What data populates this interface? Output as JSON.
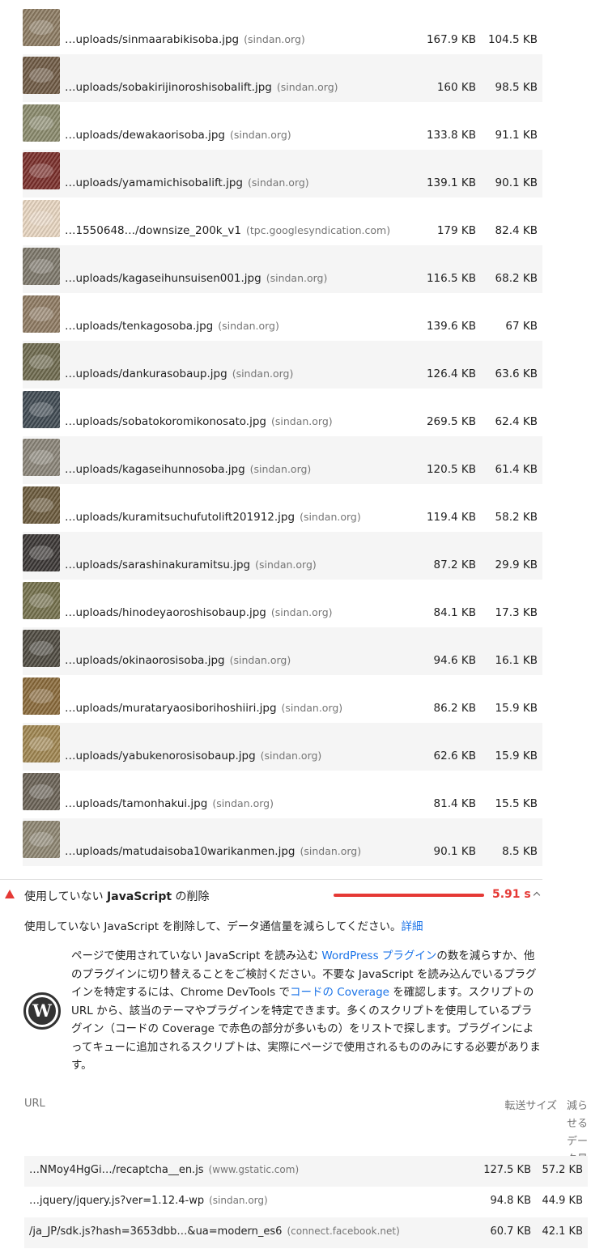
{
  "image_rows": [
    {
      "file": "…uploads/sinmaarabikisoba.jpg",
      "host": "(sindan.org)",
      "size": "167.9 KB",
      "savings": "104.5 KB",
      "thumb_color": "#8c7b62"
    },
    {
      "file": "…uploads/sobakirijinoroshisobalift.jpg",
      "host": "(sindan.org)",
      "size": "160 KB",
      "savings": "98.5 KB",
      "thumb_color": "#6f5a44"
    },
    {
      "file": "…uploads/dewakaorisoba.jpg",
      "host": "(sindan.org)",
      "size": "133.8 KB",
      "savings": "91.1 KB",
      "thumb_color": "#8a8a6c"
    },
    {
      "file": "…uploads/yamamichisobalift.jpg",
      "host": "(sindan.org)",
      "size": "139.1 KB",
      "savings": "90.1 KB",
      "thumb_color": "#7a2e2a"
    },
    {
      "file": "…1550648…/downsize_200k_v1",
      "host": "(tpc.googlesyndication.com)",
      "size": "179 KB",
      "savings": "82.4 KB",
      "thumb_color": "#e9d7c2"
    },
    {
      "file": "…uploads/kagaseihunsuisen001.jpg",
      "host": "(sindan.org)",
      "size": "116.5 KB",
      "savings": "68.2 KB",
      "thumb_color": "#7d776a"
    },
    {
      "file": "…uploads/tenkagosoba.jpg",
      "host": "(sindan.org)",
      "size": "139.6 KB",
      "savings": "67 KB",
      "thumb_color": "#8f7a62"
    },
    {
      "file": "…uploads/dankurasobaup.jpg",
      "host": "(sindan.org)",
      "size": "126.4 KB",
      "savings": "63.6 KB",
      "thumb_color": "#6e6a4e"
    },
    {
      "file": "…uploads/sobatokoromikonosato.jpg",
      "host": "(sindan.org)",
      "size": "269.5 KB",
      "savings": "62.4 KB",
      "thumb_color": "#3f4a52"
    },
    {
      "file": "…uploads/kagaseihunnosoba.jpg",
      "host": "(sindan.org)",
      "size": "120.5 KB",
      "savings": "61.4 KB",
      "thumb_color": "#8a8478"
    },
    {
      "file": "…uploads/kuramitsuchufutolift201912.jpg",
      "host": "(sindan.org)",
      "size": "119.4 KB",
      "savings": "58.2 KB",
      "thumb_color": "#6b5a3c"
    },
    {
      "file": "…uploads/sarashinakuramitsu.jpg",
      "host": "(sindan.org)",
      "size": "87.2 KB",
      "savings": "29.9 KB",
      "thumb_color": "#3a3634"
    },
    {
      "file": "…uploads/hinodeyaoroshisobaup.jpg",
      "host": "(sindan.org)",
      "size": "84.1 KB",
      "savings": "17.3 KB",
      "thumb_color": "#74704c"
    },
    {
      "file": "…uploads/okinaorosisoba.jpg",
      "host": "(sindan.org)",
      "size": "94.6 KB",
      "savings": "16.1 KB",
      "thumb_color": "#4e4a40"
    },
    {
      "file": "…uploads/murataryaosiborihoshiiri.jpg",
      "host": "(sindan.org)",
      "size": "86.2 KB",
      "savings": "15.9 KB",
      "thumb_color": "#8a6a3a"
    },
    {
      "file": "…uploads/yabukenorosisobaup.jpg",
      "host": "(sindan.org)",
      "size": "62.6 KB",
      "savings": "15.9 KB",
      "thumb_color": "#a08650"
    },
    {
      "file": "…uploads/tamonhakui.jpg",
      "host": "(sindan.org)",
      "size": "81.4 KB",
      "savings": "15.5 KB",
      "thumb_color": "#6a6256"
    },
    {
      "file": "…uploads/matudaisoba10warikanmen.jpg",
      "host": "(sindan.org)",
      "size": "90.1 KB",
      "savings": "8.5 KB",
      "thumb_color": "#8e8672"
    }
  ],
  "audit": {
    "title_prefix": "使用していない ",
    "title_bold": "JavaScript",
    "title_suffix": " の削除",
    "score": "5.91 s",
    "description": "使用していない JavaScript を削除して、データ通信量を減らしてください。",
    "learn_more": "詳細"
  },
  "wordpress": {
    "logo_letter": "W",
    "note_1": "ページで使用されていない JavaScript を読み込む ",
    "note_link_1": "WordPress プラグイン",
    "note_2": "の数を減らすか、他のプラグインに切り替えることをご検討ください。不要な JavaScript を読み込んでいるプラグインを特定するには、Chrome DevTools で",
    "note_link_2": "コードの Coverage",
    "note_3": " を確認します。スクリプトの URL から、該当のテーマやプラグインを特定できます。多くのスクリプトを使用しているプラグイン（コードの Coverage で赤色の部分が多いもの）をリストで探します。プラグインによってキューに追加されるスクリプトは、実際にページで使用されるもののみにする必要があります。"
  },
  "js_table": {
    "col_url": "URL",
    "col_size": "転送サイズ",
    "col_save": "減らせるデータ量",
    "rows": [
      {
        "file": "…NMoy4HgGi…/recaptcha__en.js",
        "host": "(www.gstatic.com)",
        "size": "127.5 KB",
        "savings": "57.2 KB"
      },
      {
        "file": "…jquery/jquery.js?ver=1.12.4-wp",
        "host": "(sindan.org)",
        "size": "94.8 KB",
        "savings": "44.9 KB"
      },
      {
        "file": "/ja_JP/sdk.js?hash=3653dbb…&ua=modern_es6",
        "host": "(connect.facebook.net)",
        "size": "60.7 KB",
        "savings": "42.1 KB"
      }
    ]
  }
}
